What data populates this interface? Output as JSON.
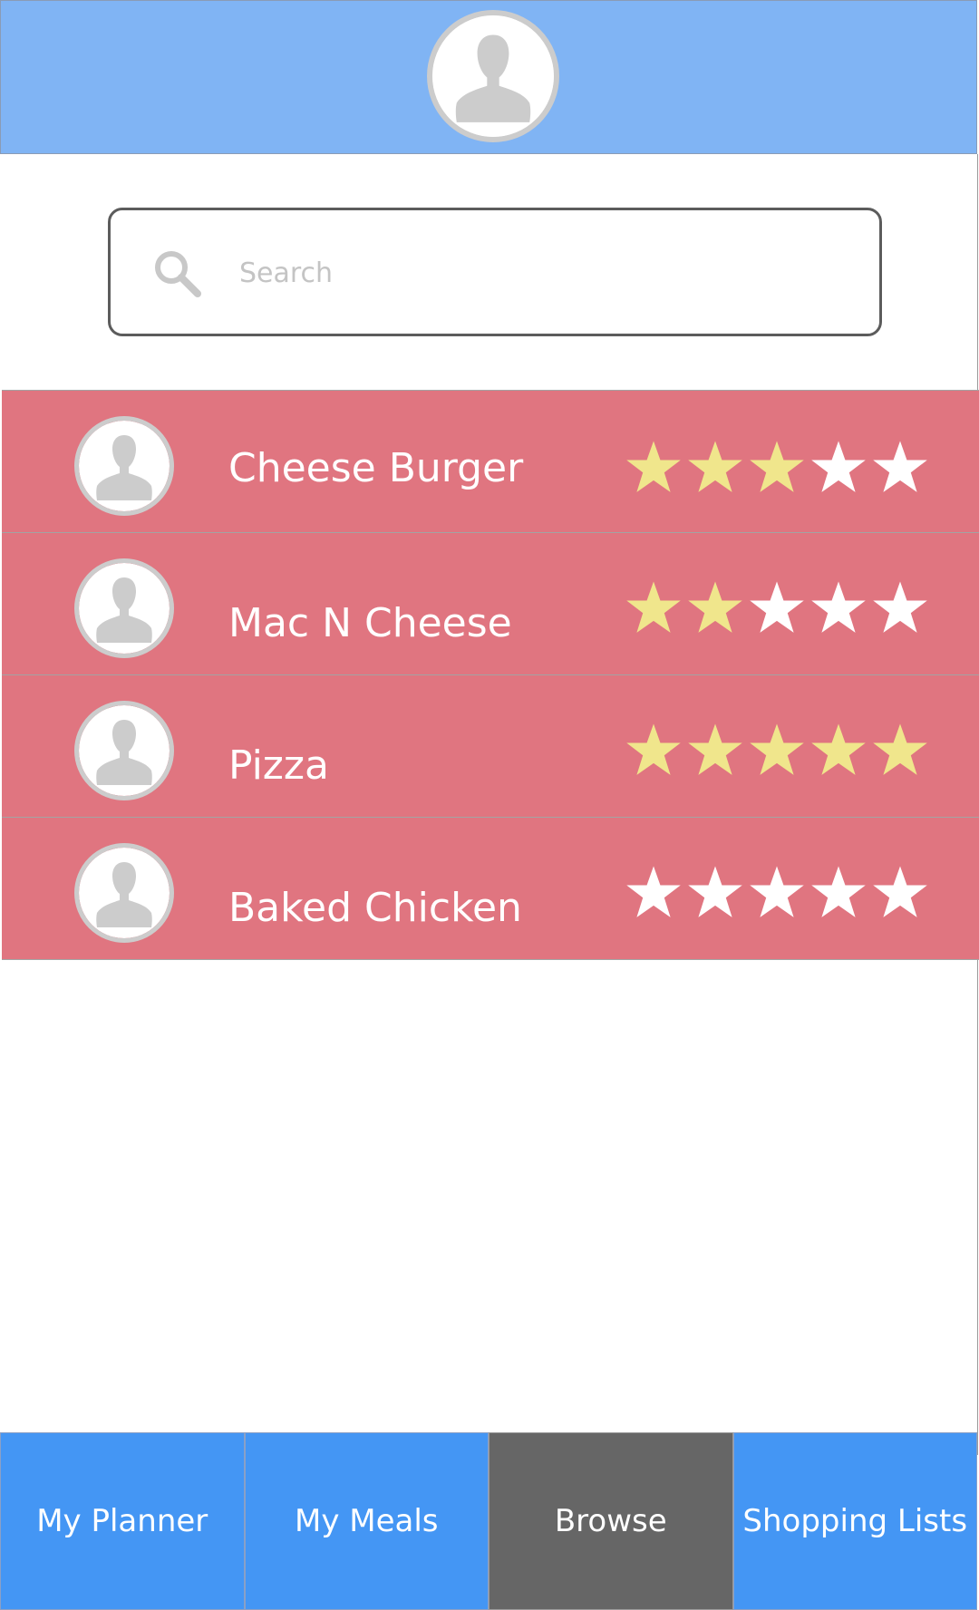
{
  "search": {
    "placeholder": "Search"
  },
  "colors": {
    "header": "#80b4f4",
    "row": "#e07580",
    "nav": "#4496f4",
    "nav_active": "#666666",
    "star_filled": "#f0e68c",
    "star_empty": "#ffffff",
    "avatar_gray": "#cccccc"
  },
  "icons": {
    "header_avatar": "user-avatar-icon",
    "search": "search-icon",
    "meal_avatar": "user-avatar-icon",
    "star": "star-icon"
  },
  "meals": [
    {
      "name": "Cheese Burger",
      "rating": 3,
      "max_rating": 5
    },
    {
      "name": "Mac N Cheese",
      "rating": 2,
      "max_rating": 5
    },
    {
      "name": "Pizza",
      "rating": 5,
      "max_rating": 5
    },
    {
      "name": "Baked Chicken",
      "rating": 0,
      "max_rating": 5
    }
  ],
  "nav": {
    "tabs": [
      {
        "label": "My Planner",
        "active": false
      },
      {
        "label": "My Meals",
        "active": false
      },
      {
        "label": "Browse",
        "active": true
      },
      {
        "label": "Shopping Lists",
        "active": false
      }
    ]
  }
}
